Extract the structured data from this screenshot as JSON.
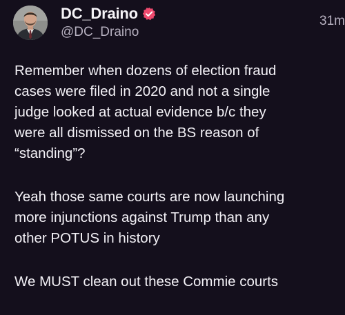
{
  "post": {
    "display_name": "DC_Draino",
    "handle": "@DC_Draino",
    "timestamp": "31m",
    "verified": true,
    "avatar_icon": "profile-photo",
    "paragraphs": [
      [
        "Remember when dozens of election fraud",
        "cases were filed in 2020 and not a single",
        "judge looked at actual evidence b/c they",
        "were all dismissed on the BS reason of",
        "“standing”?"
      ],
      [
        "Yeah those same courts are now launching",
        "more injunctions against Trump than any",
        "other POTUS in history"
      ],
      [
        "We MUST clean out these Commie courts"
      ]
    ]
  },
  "colors": {
    "background": "#140f1c",
    "text": "#f3f1f6",
    "secondary_text": "#b6b0bf",
    "verified_badge": "#ee4a6e"
  }
}
